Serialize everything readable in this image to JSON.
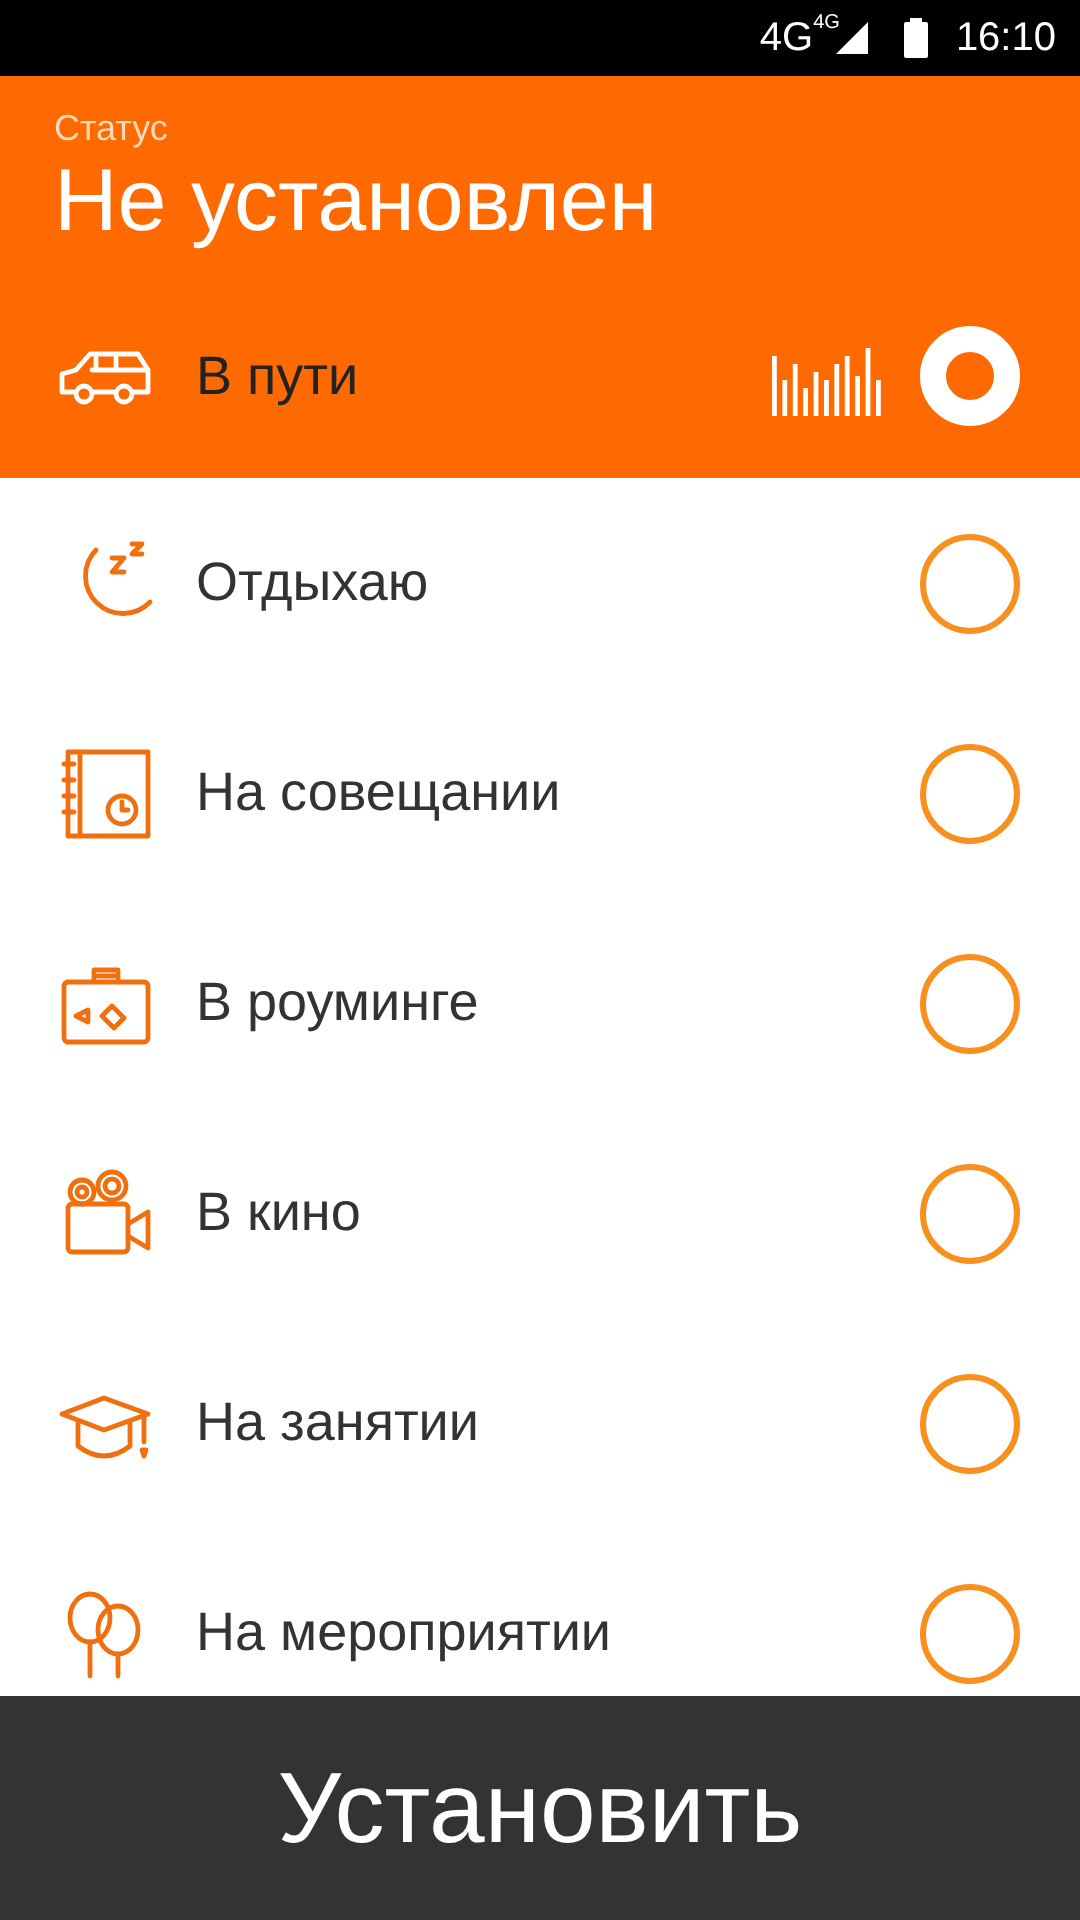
{
  "status_bar": {
    "network": "4G",
    "network_small": "4G",
    "time": "16:10"
  },
  "header": {
    "label": "Статус",
    "title": "Не установлен"
  },
  "statuses": [
    {
      "kind": "car",
      "label": "В пути",
      "selected": true
    },
    {
      "kind": "sleep",
      "label": "Отдыхаю",
      "selected": false
    },
    {
      "kind": "meeting",
      "label": "На совещании",
      "selected": false
    },
    {
      "kind": "roaming",
      "label": "В роуминге",
      "selected": false
    },
    {
      "kind": "cinema",
      "label": "В кино",
      "selected": false
    },
    {
      "kind": "study",
      "label": "На занятии",
      "selected": false
    },
    {
      "kind": "event",
      "label": "На мероприятии",
      "selected": false
    }
  ],
  "action_button": "Установить"
}
